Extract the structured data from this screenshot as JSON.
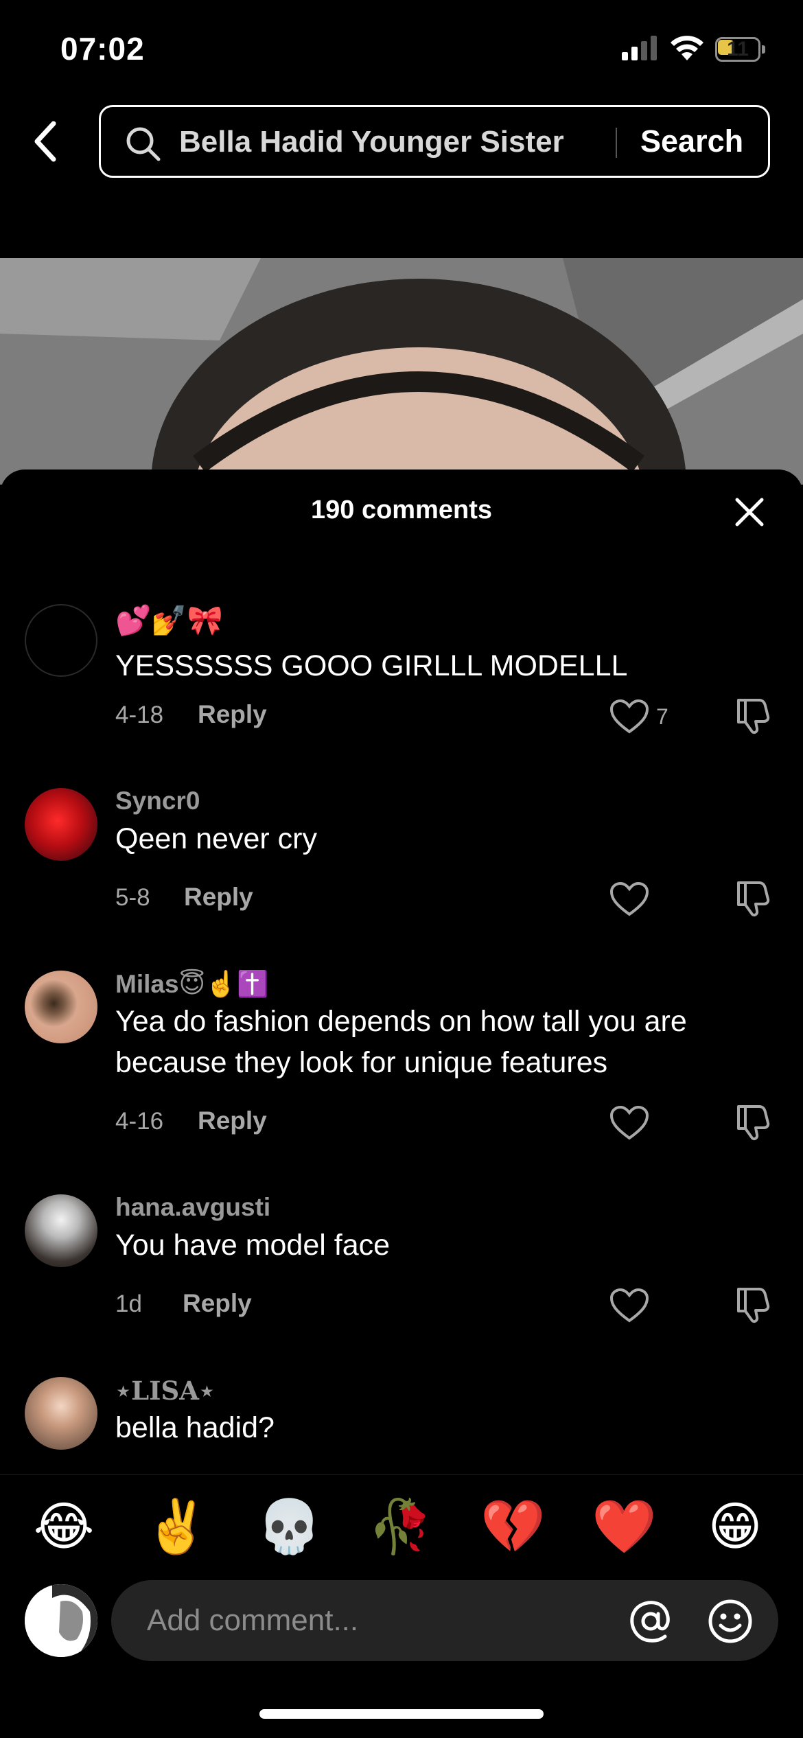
{
  "status_bar": {
    "time": "07:02",
    "battery": "11"
  },
  "search": {
    "query": "Bella Hadid Younger Sister",
    "button_label": "Search"
  },
  "sheet": {
    "title": "190 comments"
  },
  "comments": [
    {
      "username": "💕💅🎀",
      "text": "YESSSSSS GOOO GIRLLL MODELLL",
      "date": "4-18",
      "reply": "Reply",
      "likes": "7"
    },
    {
      "username": "Syncr0",
      "text": "Qeen never cry",
      "date": "5-8",
      "reply": "Reply",
      "likes": ""
    },
    {
      "username": "Milas😇☝️✝️",
      "text": "Yea do fashion depends on how tall you are because they look for unique features",
      "date": "4-16",
      "reply": "Reply",
      "likes": ""
    },
    {
      "username": "hana.avgusti",
      "text": "You have model face",
      "date": "1d",
      "reply": "Reply",
      "likes": ""
    },
    {
      "username": "⋆LISA⋆",
      "text": "bella hadid?",
      "date": "",
      "reply": "",
      "likes": ""
    }
  ],
  "emoji_bar": [
    "😂",
    "✌️",
    "💀",
    "🥀",
    "💔",
    "❤️",
    "😁"
  ],
  "comment_input": {
    "placeholder": "Add comment..."
  },
  "colors": {
    "background": "#000000",
    "muted_text": "#a8a8a8",
    "input_bg": "#242424",
    "battery": "#e7c549"
  }
}
